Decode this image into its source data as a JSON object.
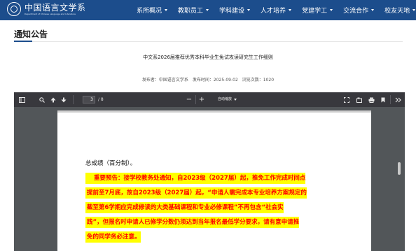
{
  "site": {
    "logo_cn": "中国语言文学系",
    "logo_en": "Department of Chinese Language and Literature",
    "nav": [
      {
        "label": "系所概况"
      },
      {
        "label": "教职员工"
      },
      {
        "label": "学科建设"
      },
      {
        "label": "人才培养"
      },
      {
        "label": "党建学工"
      },
      {
        "label": "交流合作"
      },
      {
        "label": "校友天地"
      }
    ]
  },
  "page": {
    "section_title": "通知公告",
    "article_title": "中文系2026届推荐优秀本科毕业生免试攻读研究生工作细则",
    "meta": {
      "publisher": "发布者：中国语言文学系",
      "publish_time": "发布时间：2025-09-02",
      "views": "浏览次数：1020"
    }
  },
  "pdf_viewer": {
    "toolbar": {
      "sidebar_icon": "sidebar-toggle-icon",
      "search_icon": "search-icon",
      "prev_icon": "arrow-up-icon",
      "next_icon": "arrow-down-icon",
      "current_page": "3",
      "total_pages": "/ 8",
      "zoom_out": "−",
      "zoom_in": "+",
      "zoom_level": "自动缩放",
      "presentation_icon": "expand-icon",
      "open_icon": "open-file-icon",
      "print_icon": "print-icon",
      "bookmark_icon": "bookmark-icon",
      "more_icon": "double-chevron-right-icon"
    },
    "content": {
      "line_plain": "总成绩（百分制）。",
      "highlight_lines": [
        "重要预告：接学校教务处通知，自2023级（2027届）起，推免工作完成时间点",
        "提前至7月底，故自2023级（2027届）起，“申请人需完成本专业培养方案规定的",
        "截至第6学期应完成修读的大类基础课程和专业必修课程”不再包含“社会实",
        "践”，但报名时申请人已修学分数仍须达到当年报名最低学分要求，请有意申请推",
        "免的同学务必注意。"
      ]
    }
  },
  "colors": {
    "nav_bg": "#1c4d8c",
    "highlight_bg": "#ffff00",
    "highlight_text": "#ff0000",
    "viewer_bg": "#525659",
    "toolbar_bg": "#38383d"
  }
}
